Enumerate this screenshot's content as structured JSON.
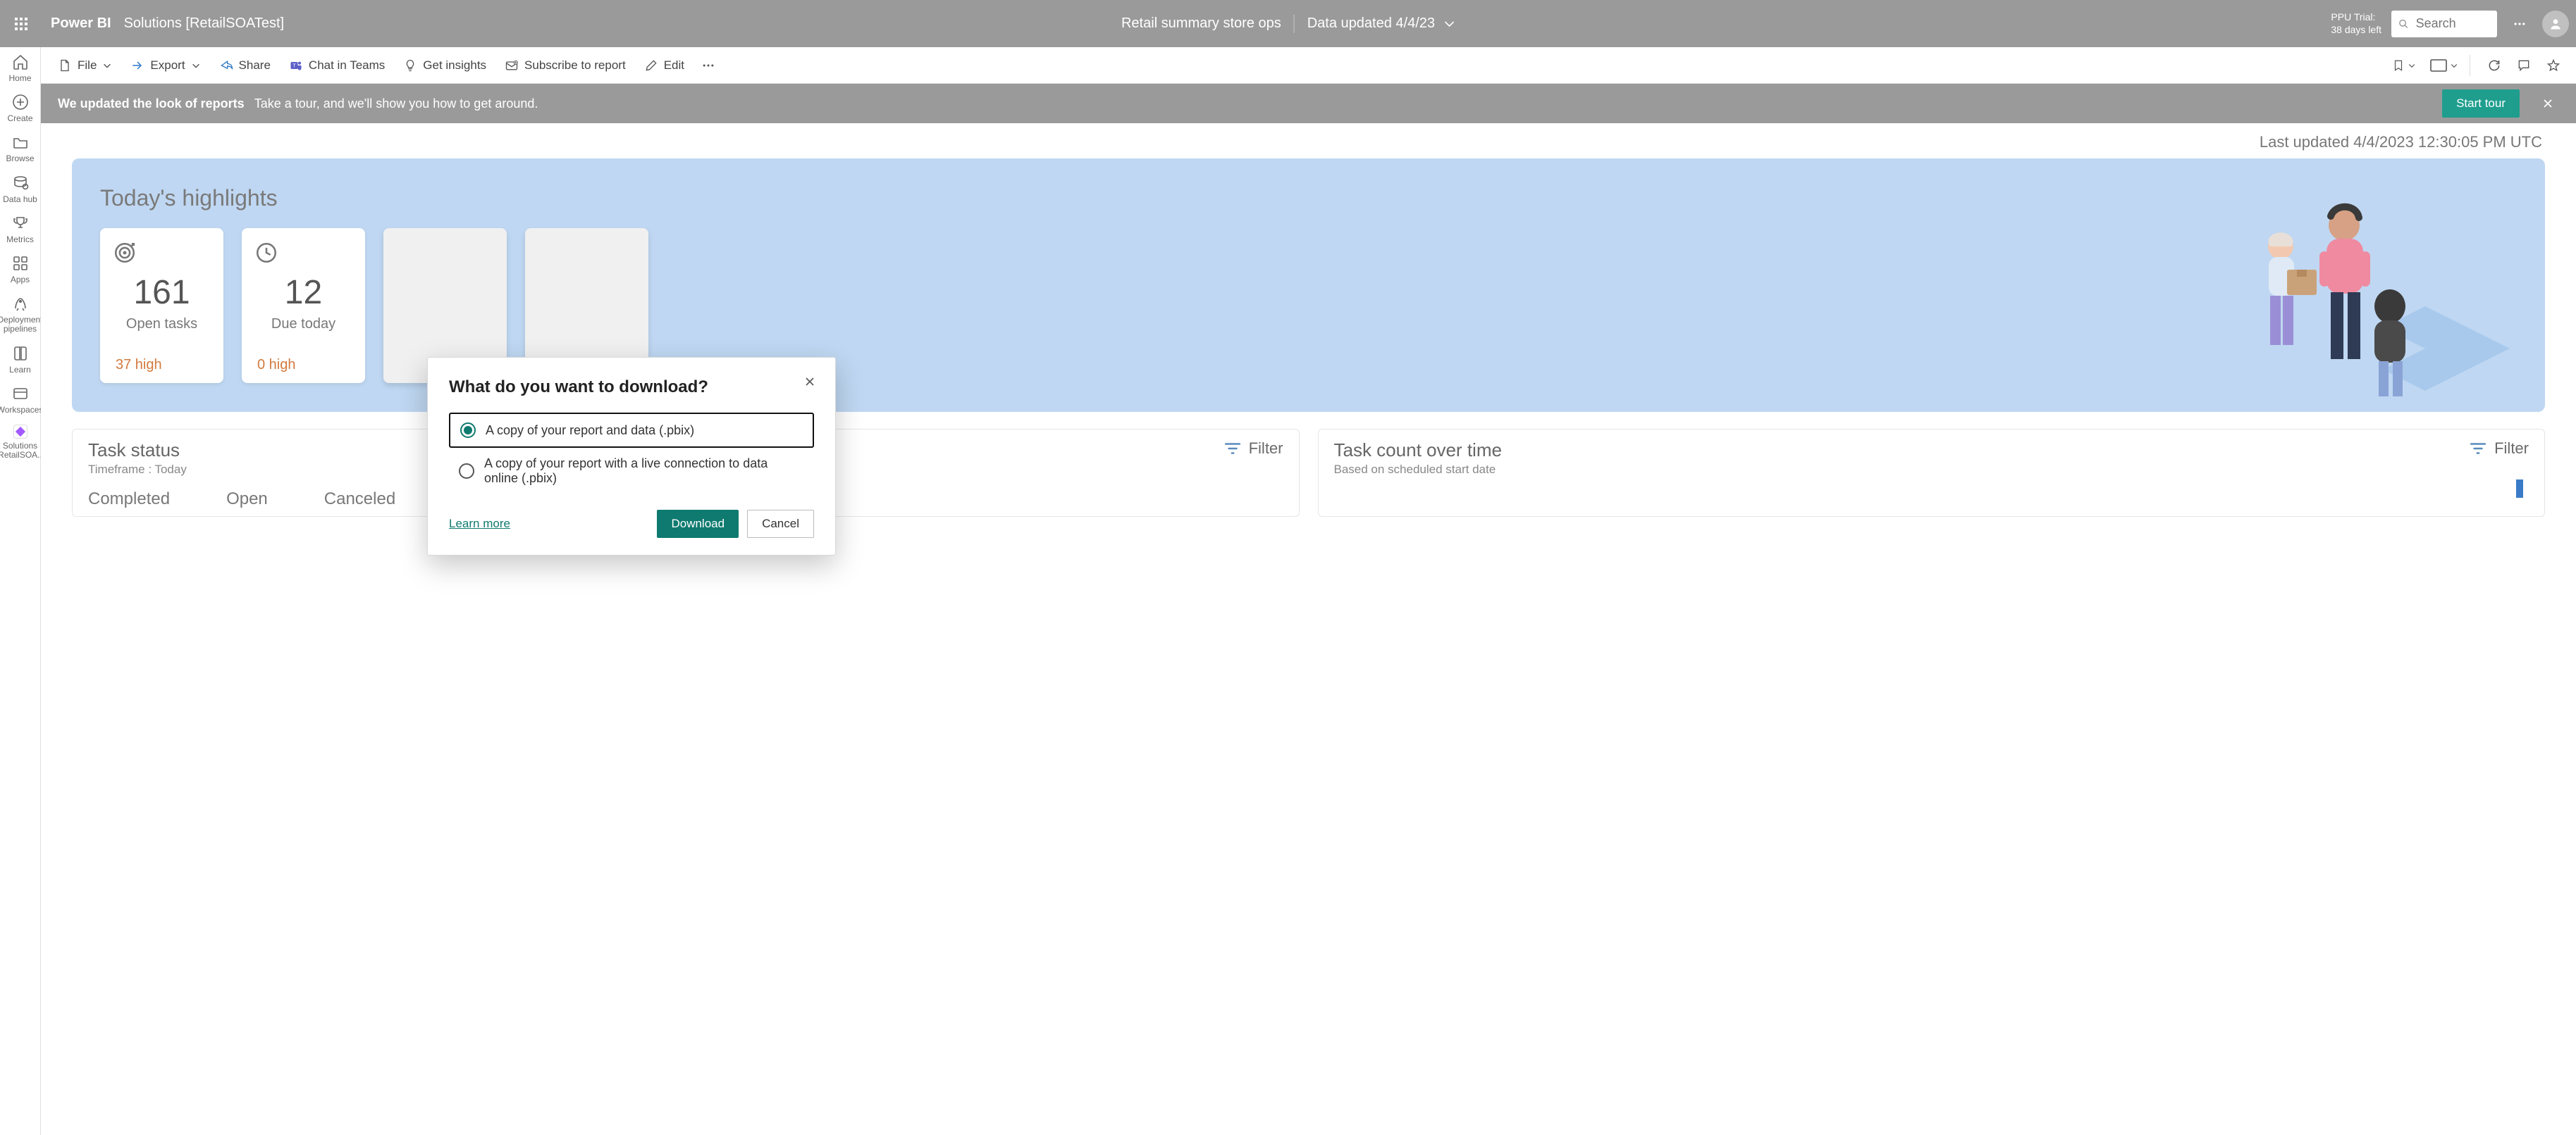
{
  "header": {
    "brand": "Power BI",
    "workspace": "Solutions [RetailSOATest]",
    "report_title": "Retail summary store ops",
    "data_updated": "Data updated 4/4/23",
    "trial_line1": "PPU Trial:",
    "trial_line2": "38 days left",
    "search_placeholder": "Search"
  },
  "nav": {
    "items": [
      {
        "label": "Home"
      },
      {
        "label": "Create"
      },
      {
        "label": "Browse"
      },
      {
        "label": "Data hub"
      },
      {
        "label": "Metrics"
      },
      {
        "label": "Apps"
      },
      {
        "label": "Deployment pipelines"
      },
      {
        "label": "Learn"
      },
      {
        "label": "Workspaces"
      },
      {
        "label": "Solutions [RetailSOA..."
      }
    ]
  },
  "actions": {
    "file": "File",
    "export": "Export",
    "share": "Share",
    "chat_teams": "Chat in Teams",
    "insights": "Get insights",
    "subscribe": "Subscribe to report",
    "edit": "Edit"
  },
  "tour": {
    "bold": "We updated the look of reports",
    "text": "Take a tour, and we'll show you how to get around.",
    "button": "Start tour"
  },
  "report": {
    "last_updated": "Last updated 4/4/2023 12:30:05 PM UTC",
    "highlights_title": "Today's highlights",
    "cards": [
      {
        "value": "161",
        "label": "Open tasks",
        "high": "37 high"
      },
      {
        "value": "12",
        "label": "Due today",
        "high": "0 high"
      }
    ],
    "panel_task_status": {
      "title": "Task status",
      "sub": "Timeframe : Today",
      "filter": "Filter",
      "cols": [
        "Completed",
        "Open",
        "Canceled"
      ]
    },
    "panel_task_count": {
      "title": "Task count over time",
      "sub": "Based on scheduled start date",
      "filter": "Filter"
    }
  },
  "modal": {
    "title": "What do you want to download?",
    "option1": "A copy of your report and data (.pbix)",
    "option2": "A copy of your report with a live connection to data online (.pbix)",
    "learn_more": "Learn more",
    "download": "Download",
    "cancel": "Cancel"
  }
}
